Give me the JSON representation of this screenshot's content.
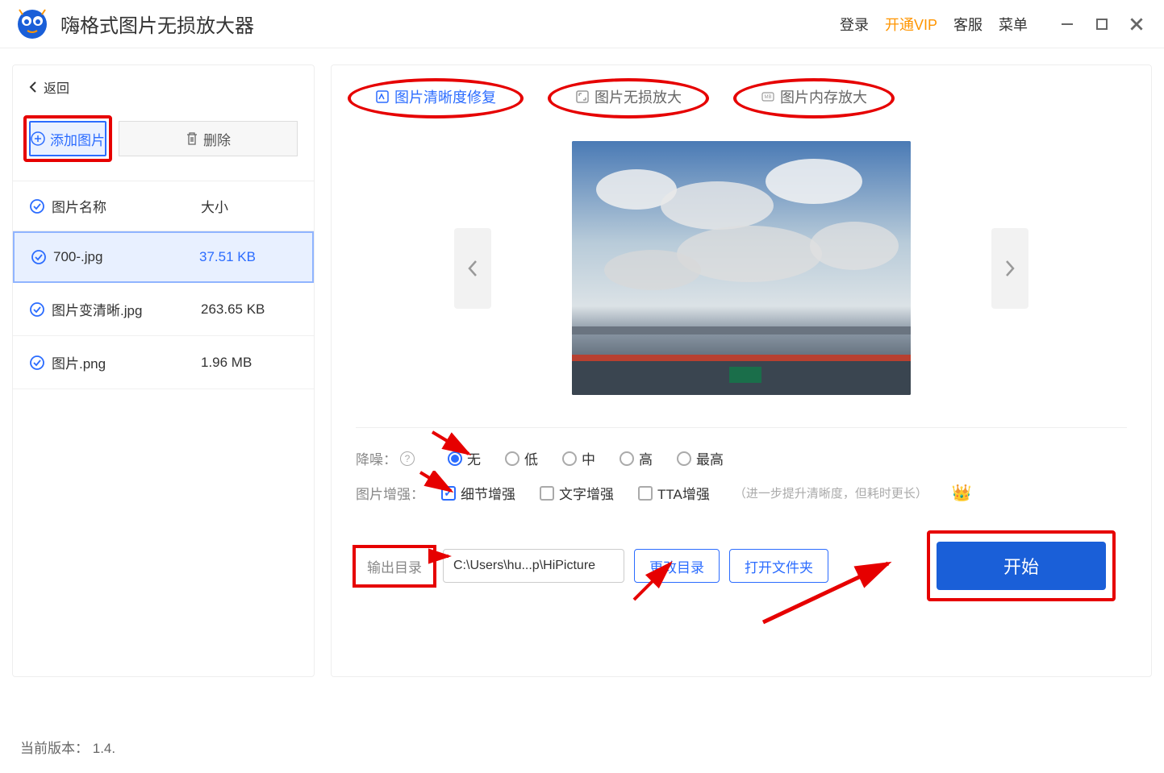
{
  "titlebar": {
    "app_name": "嗨格式图片无损放大器",
    "login": "登录",
    "vip": "开通VIP",
    "support": "客服",
    "menu": "菜单"
  },
  "left": {
    "back": "返回",
    "add_button": "添加图片",
    "delete_button": "删除",
    "header_name": "图片名称",
    "header_size": "大小",
    "files": [
      {
        "name": "700-.jpg",
        "size": "37.51 KB",
        "selected": true
      },
      {
        "name": "图片变清晰.jpg",
        "size": "263.65 KB",
        "selected": false
      },
      {
        "name": "图片.png",
        "size": "1.96 MB",
        "selected": false
      }
    ]
  },
  "tabs": {
    "clarity": "图片清晰度修复",
    "lossless": "图片无损放大",
    "memory": "图片内存放大"
  },
  "options": {
    "noise_label": "降噪：",
    "noise": {
      "none": "无",
      "low": "低",
      "mid": "中",
      "high": "高",
      "highest": "最高"
    },
    "enhance_label": "图片增强：",
    "enhance": {
      "detail": "细节增强",
      "text": "文字增强",
      "tta": "TTA增强"
    },
    "enhance_hint": "（进一步提升清晰度，但耗时更长）"
  },
  "output": {
    "label": "输出目录",
    "path": "C:\\Users\\hu...p\\HiPicture",
    "change": "更改目录",
    "open": "打开文件夹",
    "start": "开始"
  },
  "footer": {
    "version_label": "当前版本：",
    "version": "1.4."
  }
}
